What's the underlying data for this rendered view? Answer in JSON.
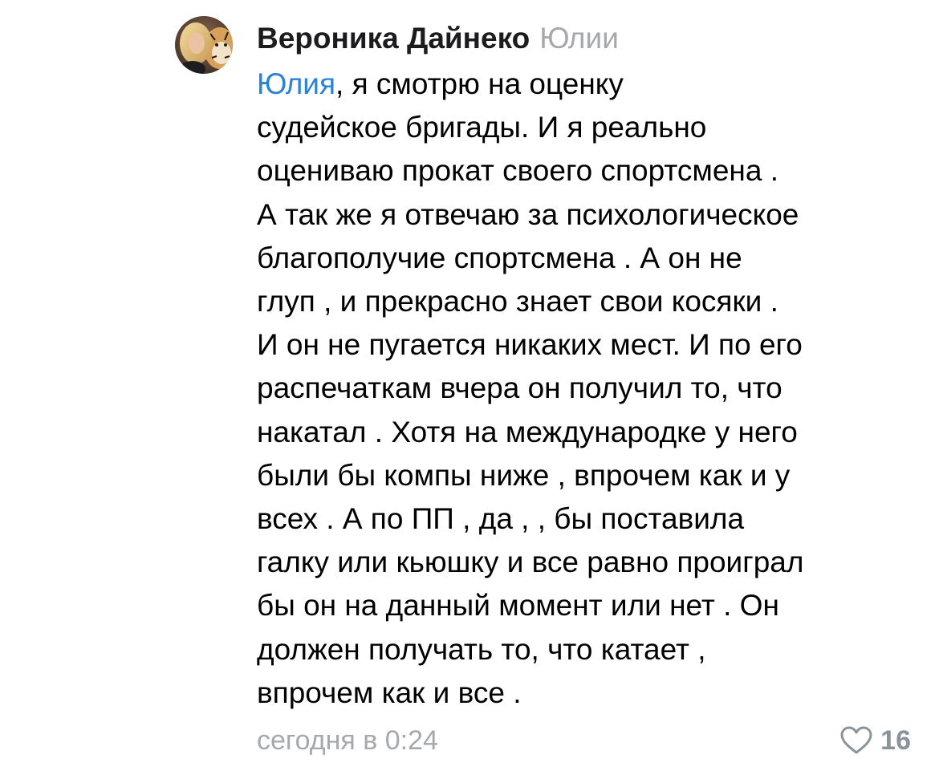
{
  "comment": {
    "author": "Вероника Дайнеко",
    "reply_to": "Юлии",
    "mention": "Юлия",
    "text_lines": [
      ", я смотрю на оценку",
      "судейское бригады. И я реально",
      "оцениваю прокат своего спортсмена .",
      "А так же я отвечаю за психологическое",
      "благополучие спортсмена . А он не",
      "глуп , и прекрасно знает свои косяки .",
      "И он не пугается никаких мест. И по его",
      "распечаткам вчера он получил то, что",
      "накатал . Хотя на международке у него",
      "были бы компы ниже , впрочем как и у",
      "всех . А по ПП , да , , бы поставила",
      "галку или кьюшку и все равно проиграл",
      "бы он на данный момент или нет . Он",
      "должен получать то, что катает ,",
      "впрочем как и все ."
    ],
    "timestamp": "сегодня в 0:24",
    "like_count": "16",
    "like_icon": "heart-outline-icon",
    "avatar_icon": "user-avatar-photo"
  },
  "colors": {
    "author": "#1c1c1e",
    "secondary": "#a5a9ae",
    "mention": "#2b82d6",
    "like": "#8d939a",
    "background": "#ffffff"
  }
}
